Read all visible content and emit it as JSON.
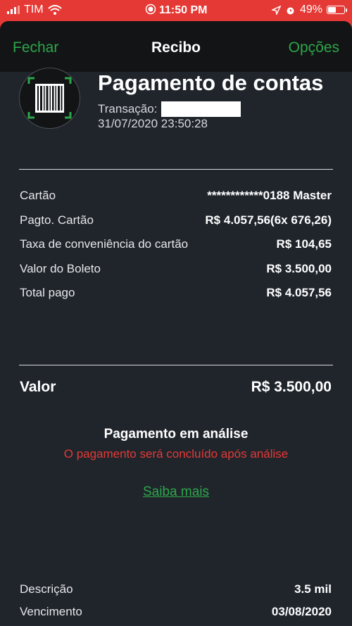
{
  "status_bar": {
    "carrier": "TIM",
    "time": "11:50 PM",
    "battery": "49%",
    "battery_level": 0.49
  },
  "navbar": {
    "close_label": "Fechar",
    "title": "Recibo",
    "options_label": "Opções"
  },
  "header": {
    "title": "Pagamento de contas",
    "transaction_label": "Transação:",
    "datetime": "31/07/2020 23:50:28"
  },
  "details": [
    {
      "label": "Cartão",
      "value": "************0188 Master"
    },
    {
      "label": "Pagto. Cartão",
      "value": "R$ 4.057,56(6x 676,26)"
    },
    {
      "label": "Taxa de conveniência do cartão",
      "value": "R$ 104,65"
    },
    {
      "label": "Valor do Boleto",
      "value": "R$ 3.500,00"
    },
    {
      "label": "Total pago",
      "value": "R$ 4.057,56"
    }
  ],
  "total": {
    "label": "Valor",
    "value": "R$ 3.500,00"
  },
  "status": {
    "title": "Pagamento em análise",
    "subtitle": "O pagamento será concluído após análise",
    "link": "Saiba mais"
  },
  "extra": [
    {
      "label": "Descrição",
      "value": "3.5 mil"
    },
    {
      "label": "Vencimento",
      "value": "03/08/2020"
    }
  ],
  "colors": {
    "accent_green": "#2ea64a",
    "alert_red": "#e53935",
    "status_bar_red": "#e53935",
    "background": "#20252c"
  },
  "icons": [
    "signal-icon",
    "wifi-icon",
    "record-icon",
    "location-icon",
    "alarm-icon",
    "battery-icon",
    "barcode-icon"
  ]
}
